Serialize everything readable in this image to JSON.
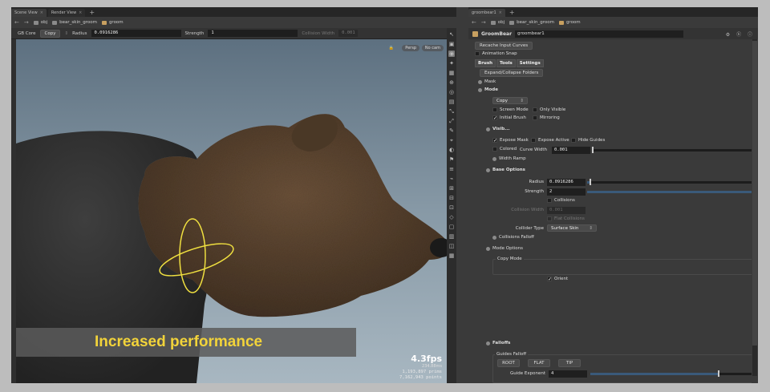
{
  "left_pane": {
    "tabs": [
      {
        "label": "Scene View"
      },
      {
        "label": "Render View"
      }
    ],
    "path": [
      "obj",
      "bear_skin_groom",
      "groom"
    ],
    "toolbar": {
      "mode_label": "GB Core",
      "copy_btn": "Copy",
      "radius_label": "Radius",
      "radius_value": "0.0916286",
      "strength_label": "Strength",
      "strength_value": "1",
      "collision_label": "Collision Width",
      "collision_value": "0.001"
    },
    "viewport": {
      "persp_label": "Persp",
      "cam_label": "No cam",
      "fps": "4.3fps",
      "fps_ms": "234.88ms",
      "prims": "1,193,897  prims",
      "points": "7,162,943  points"
    },
    "banner": "Increased performance"
  },
  "right_pane": {
    "tab": "groombear1",
    "path": [
      "obj",
      "bear_skin_groom",
      "groom"
    ],
    "node_type": "GroomBear",
    "node_name": "groombear1",
    "recache_btn": "Recache Input Curves",
    "anim_snap": "Animation Snap",
    "subtabs": [
      "Brush",
      "Tools",
      "Settings"
    ],
    "expand_btn": "Expand/Collapse Folders",
    "mask": "Mask",
    "mode": "Mode",
    "copy_dd": "Copy",
    "screen_mode": "Screen Mode",
    "only_visible": "Only Visible",
    "initial_brush": "Initial Brush",
    "mirroring": "Mirroring",
    "visib": "Visib...",
    "expose_mask": "Expose Mask",
    "expose_active": "Expose Active",
    "hide_guides": "Hide Guides",
    "colored": "Colored",
    "curve_width_label": "Curve Width",
    "curve_width": "0.001",
    "width_ramp": "Width Ramp",
    "base_options": "Base Options",
    "radius_label": "Radius",
    "radius": "0.0916286",
    "strength_label": "Strength",
    "strength": "2",
    "collisions": "Collisions",
    "collision_width_label": "Collision Width",
    "collision_width": "0.001",
    "flat_collisions": "Flat Collisions",
    "collider_type_label": "Collider Type",
    "collider_type": "Surface Skin",
    "collisions_falloff": "Collisions Falloff",
    "mode_options": "Mode Options",
    "copy_mode": "Copy Mode",
    "orient": "Orient",
    "falloffs": "Falloffs",
    "guides_falloff": "Guides Falloff",
    "falloff_btns": [
      "ROOT",
      "FLAT",
      "TIP"
    ],
    "guide_exp_label": "Guide Exponent",
    "guide_exp": "4"
  },
  "values": {
    "radius_fill": 0.02,
    "strength_fill": 0.99,
    "curve_width_fill": 0.0,
    "guide_exp_fill": 0.76
  },
  "colors": {
    "banner_text": "#f2d33a",
    "fur": "#5a4330",
    "selection": "#f0e040"
  }
}
